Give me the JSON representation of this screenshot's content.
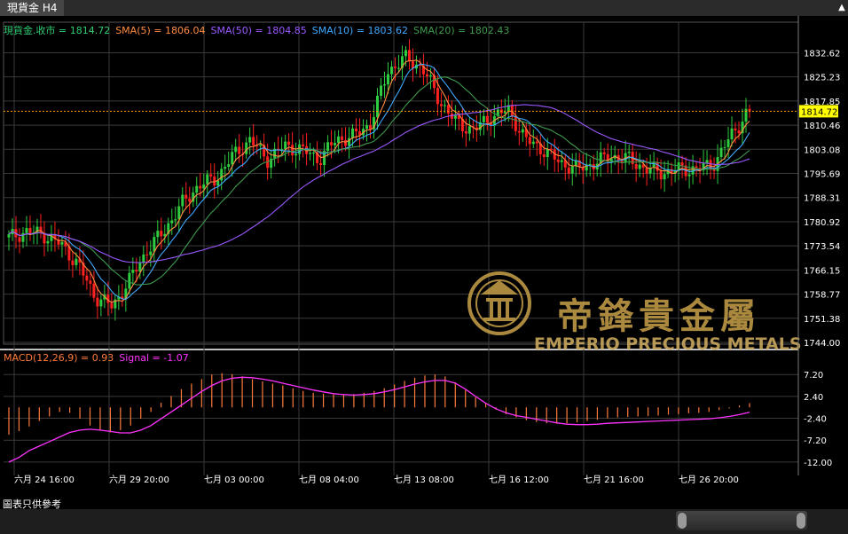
{
  "tab": {
    "label": "現貨金 H4"
  },
  "legend_main": [
    {
      "text": "現貨金.收市 = 1814.72",
      "color": "#2ecc71"
    },
    {
      "text": "SMA(5) = 1806.04",
      "color": "#ff8c42"
    },
    {
      "text": "SMA(50) = 1804.85",
      "color": "#9b59ff"
    },
    {
      "text": "SMA(10) = 1803.62",
      "color": "#3fa9ff"
    },
    {
      "text": "SMA(20) = 1802.43",
      "color": "#3f9a4e"
    }
  ],
  "legend_macd": [
    {
      "text": "MACD(12,26,9) = 0.93",
      "color": "#ff7b3a"
    },
    {
      "text": "Signal = -1.07",
      "color": "#ff33ff"
    }
  ],
  "watermark": {
    "cn": "帝鋒貴金屬",
    "en": "EMPERIO PRECIOUS METALS"
  },
  "note": "圖表只供參考",
  "chart_data": {
    "type": "candlestick",
    "price_axis": {
      "ylim": [
        1744.0,
        1836.0
      ],
      "ticks": [
        "1832.62",
        "1825.23",
        "1817.85",
        "1810.46",
        "1803.08",
        "1795.69",
        "1788.31",
        "1780.92",
        "1773.54",
        "1766.15",
        "1758.77",
        "1751.38",
        "1744.00"
      ]
    },
    "last_price": {
      "value": 1814.72,
      "label": "1814.72"
    },
    "macd_axis": {
      "ylim": [
        -13.0,
        9.0
      ],
      "ticks": [
        "7.20",
        "2.40",
        "-2.40",
        "-7.20",
        "-12.00"
      ]
    },
    "time_labels": [
      "六月 24 16:00",
      "六月 29 20:00",
      "七月 03 00:00",
      "七月 08 04:00",
      "七月 13 08:00",
      "七月 16 12:00",
      "七月 21 16:00",
      "七月 26 20:00"
    ],
    "close_anchors": [
      1776,
      1778,
      1777,
      1774,
      1768,
      1758,
      1755,
      1763,
      1772,
      1778,
      1786,
      1792,
      1794,
      1801,
      1806,
      1800,
      1804,
      1803,
      1800,
      1806,
      1807,
      1811,
      1827,
      1831,
      1828,
      1818,
      1811,
      1809,
      1813,
      1815,
      1806,
      1803,
      1799,
      1797,
      1799,
      1801,
      1800,
      1797,
      1796,
      1797,
      1797,
      1799,
      1808,
      1815
    ],
    "macd_hist": [
      -6,
      -5.2,
      -4.2,
      -3,
      -2,
      -1,
      -1.2,
      -2.5,
      -4,
      -5,
      -5.5,
      -5,
      -4,
      -2.5,
      -1,
      1,
      2.5,
      4,
      5.2,
      6.2,
      7.2,
      7.5,
      7.3,
      6.8,
      6.2,
      5.7,
      5.2,
      4.8,
      4.2,
      3.6,
      3.2,
      3.0,
      2.8,
      2.7,
      2.9,
      3.2,
      3.6,
      4.2,
      5.0,
      5.8,
      6.5,
      7.0,
      7.2,
      6.8,
      5.5,
      3.8,
      2.2,
      0.8,
      -0.5,
      -1.5,
      -2.2,
      -2.8,
      -3.2,
      -3.5,
      -3.6,
      -3.5,
      -3.3,
      -3.0,
      -2.7,
      -2.4,
      -2.2,
      -2.1,
      -2.0,
      -1.9,
      -1.8,
      -1.6,
      -1.5,
      -1.3,
      -1.2,
      -1.0,
      -0.6,
      -0.2,
      0.4,
      0.93
    ],
    "macd_signal": [
      -12,
      -11,
      -9.5,
      -8.5,
      -7.5,
      -6.5,
      -5.5,
      -5,
      -4.8,
      -5,
      -5.3,
      -5.6,
      -5.6,
      -5,
      -4,
      -2.5,
      -1,
      0.5,
      2,
      3.5,
      4.8,
      5.8,
      6.4,
      6.6,
      6.5,
      6.2,
      5.8,
      5.3,
      4.8,
      4.3,
      3.8,
      3.4,
      3.0,
      2.8,
      2.7,
      2.8,
      3.0,
      3.4,
      3.9,
      4.5,
      5.1,
      5.6,
      5.9,
      5.9,
      5.3,
      4.0,
      2.4,
      0.9,
      -0.3,
      -1.2,
      -1.8,
      -2.2,
      -2.6,
      -3.0,
      -3.4,
      -3.7,
      -3.8,
      -3.8,
      -3.7,
      -3.5,
      -3.4,
      -3.3,
      -3.2,
      -3.1,
      -3.0,
      -2.9,
      -2.8,
      -2.7,
      -2.6,
      -2.5,
      -2.3,
      -2.0,
      -1.6,
      -1.07
    ]
  },
  "colors": {
    "up": "#2ecc40",
    "down": "#ff2020",
    "grid": "#3a3a3a",
    "axis_text": "#ffffff",
    "last_price_bg": "#ffff00"
  }
}
